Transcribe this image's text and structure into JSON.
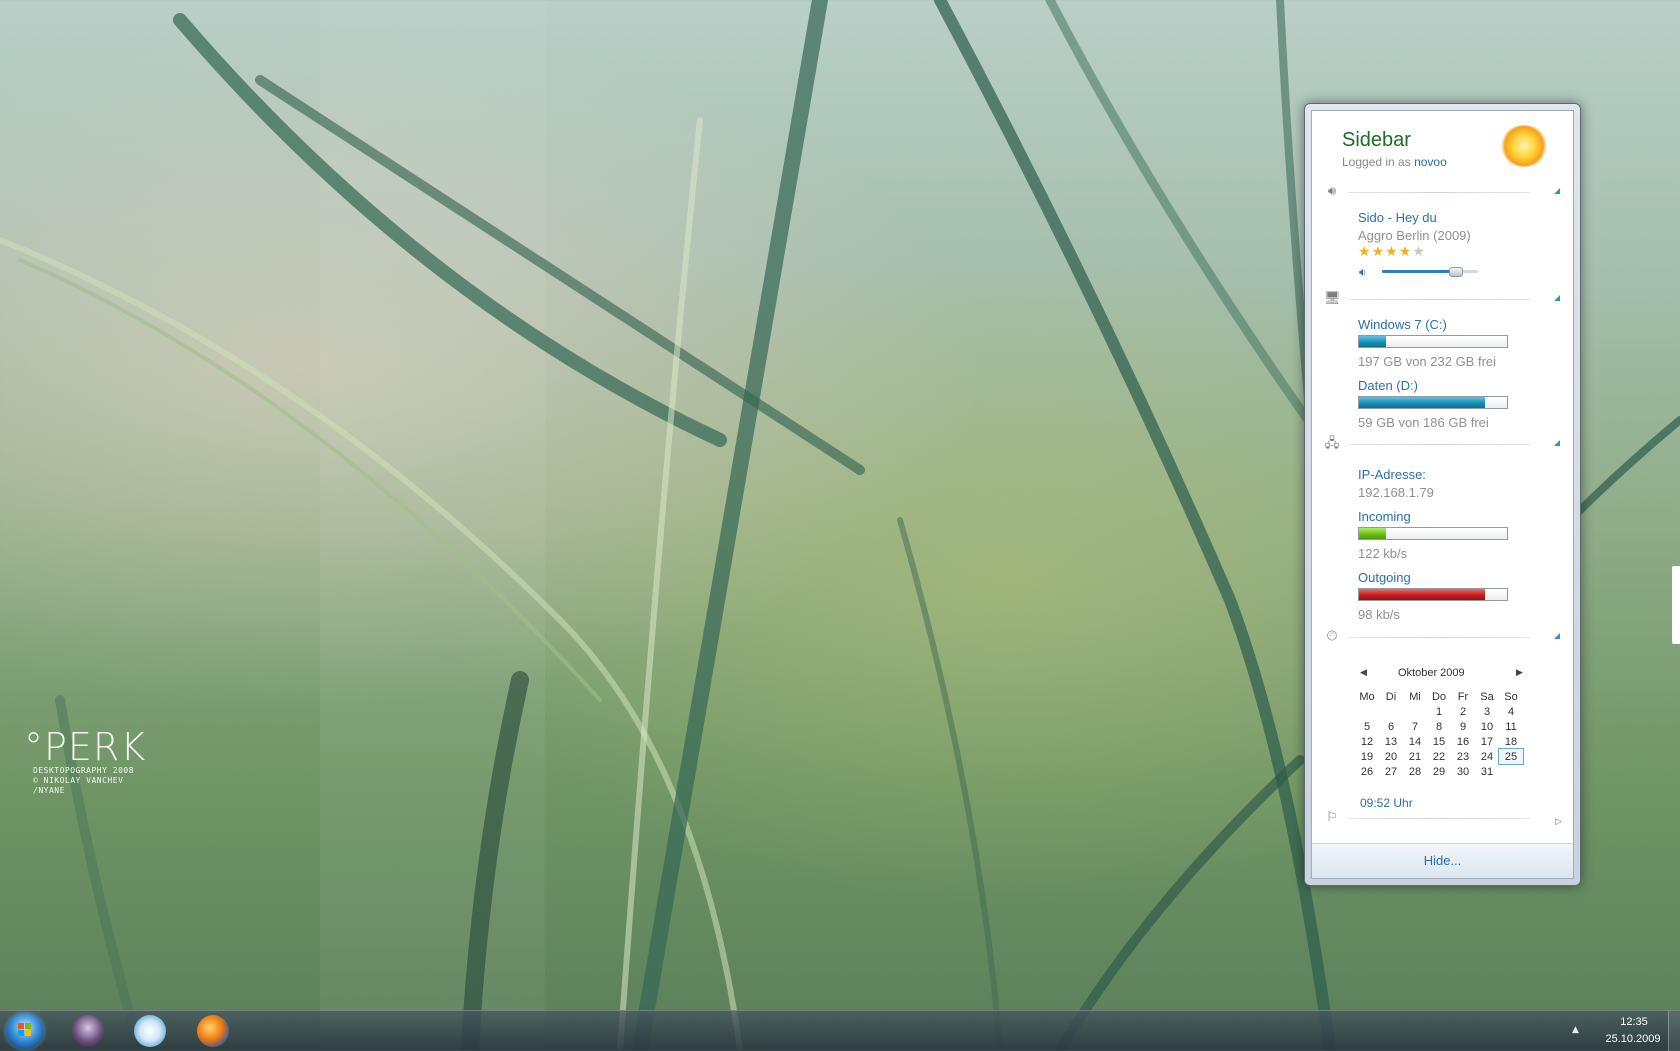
{
  "desktop": {
    "wallpaper_name": "grass wallpaper",
    "perk": {
      "title": "°PERK",
      "line1": "DESKTOPOGRAPHY 2008",
      "line2": "© NIKOLAY VANCHEV",
      "line3": "/NYANE"
    }
  },
  "sidebar": {
    "title": "Sidebar",
    "logged_in_prefix": "Logged in as ",
    "user": "novoo",
    "weather_icon": "sun-icon",
    "music": {
      "icon": "speaker-icon",
      "track": "Sido - Hey du",
      "album": "Aggro Berlin (2009)",
      "rating": 4,
      "rating_max": 5,
      "volume": 0.77
    },
    "drives": {
      "icon": "monitor-icon",
      "items": [
        {
          "name": "Windows 7 (C:)",
          "usage": "197 GB von 232 GB frei",
          "fill": 0.18
        },
        {
          "name": "Daten (D:)",
          "usage": "59 GB von 186 GB frei",
          "fill": 0.85
        }
      ]
    },
    "network": {
      "icon": "network-icon",
      "ip_label": "IP-Adresse:",
      "ip_value": "192.168.1.79",
      "incoming_label": "Incoming",
      "incoming_value": "122 kb/s",
      "incoming_fill": 0.18,
      "outgoing_label": "Outgoing",
      "outgoing_value": "98 kb/s",
      "outgoing_fill": 0.85
    },
    "calendar": {
      "icon": "clock-calendar-icon",
      "month_label": "Oktober 2009",
      "weekdays": [
        "Mo",
        "Di",
        "Mi",
        "Do",
        "Fr",
        "Sa",
        "So"
      ],
      "weeks": [
        [
          "",
          "",
          "",
          "1",
          "2",
          "3",
          "4"
        ],
        [
          "5",
          "6",
          "7",
          "8",
          "9",
          "10",
          "11"
        ],
        [
          "12",
          "13",
          "14",
          "15",
          "16",
          "17",
          "18"
        ],
        [
          "19",
          "20",
          "21",
          "22",
          "23",
          "24",
          "25"
        ],
        [
          "26",
          "27",
          "28",
          "29",
          "30",
          "31",
          ""
        ]
      ],
      "today": "25",
      "time": "09:52 Uhr"
    },
    "flag_icon": "flag-icon",
    "hide_label": "Hide..."
  },
  "taskbar": {
    "items": [
      "start-orb",
      "users-app",
      "media-player",
      "firefox"
    ],
    "time": "12:35",
    "date": "25.10.2009"
  }
}
